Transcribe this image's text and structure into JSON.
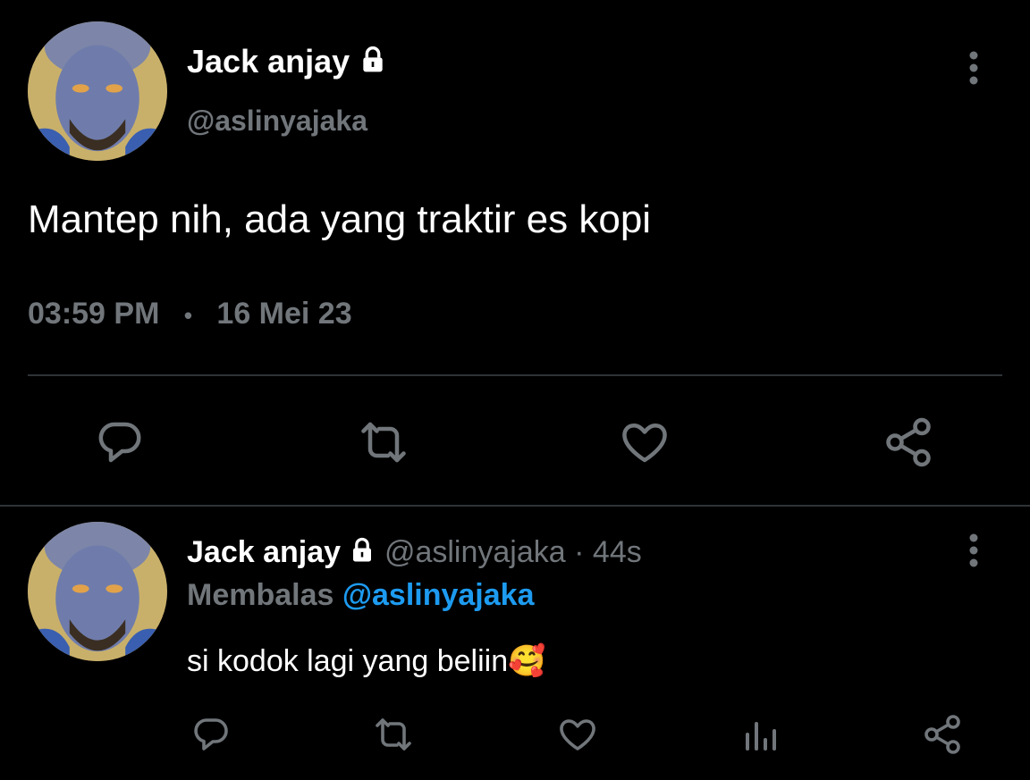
{
  "main_tweet": {
    "author_name": "Jack anjay",
    "handle": "@aslinyajaka",
    "text": "Mantep nih, ada yang traktir es kopi",
    "time": "03:59 PM",
    "separator": "•",
    "date": "16 Mei 23",
    "icons": [
      "reply-icon",
      "retweet-icon",
      "like-icon",
      "share-icon"
    ]
  },
  "reply_tweet": {
    "author_name": "Jack anjay",
    "handle": "@aslinyajaka",
    "dot": "·",
    "age": "44s",
    "replying_prefix": "Membalas",
    "replying_to": "@aslinyajaka",
    "text": "si kodok lagi yang beliin",
    "emoji": "🥰",
    "icons": [
      "reply-icon",
      "retweet-icon",
      "like-icon",
      "views-icon",
      "share-icon"
    ]
  },
  "colors": {
    "background": "#000000",
    "primary_text": "#e7e9ea",
    "secondary_text": "#71767b",
    "link": "#1d9bf0",
    "divider": "#2f3336"
  }
}
